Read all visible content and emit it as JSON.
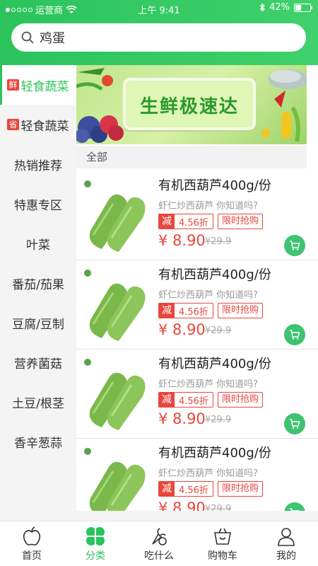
{
  "status": {
    "carrier": "运营商",
    "time": "上午 9:41",
    "battery": "42%",
    "battery_level": 0.42
  },
  "search": {
    "value": "鸡蛋"
  },
  "sidebar": {
    "items": [
      {
        "tag": "鲜",
        "label": "轻食蔬菜"
      },
      {
        "tag": "省",
        "label": "轻食蔬菜"
      },
      {
        "label": "热销推荐"
      },
      {
        "label": "特惠专区"
      },
      {
        "label": "叶菜"
      },
      {
        "label": "番茄/茄果"
      },
      {
        "label": "豆腐/豆制"
      },
      {
        "label": "营养菌菇"
      },
      {
        "label": "土豆/根茎"
      },
      {
        "label": "香辛葱蒜"
      }
    ]
  },
  "banner": {
    "title": "生鲜极速达"
  },
  "section": {
    "label": "全部"
  },
  "products": [
    {
      "name": "有机西葫芦400g/份",
      "desc": "虾仁炒西葫芦 你知道吗?",
      "jian": "减",
      "rate": "4.56折",
      "flash": "限时抢购",
      "price": "¥ 8.90",
      "old_price": "¥29.9"
    },
    {
      "name": "有机西葫芦400g/份",
      "desc": "虾仁炒西葫芦 你知道吗?",
      "jian": "减",
      "rate": "4.56折",
      "flash": "限时抢购",
      "price": "¥ 8.90",
      "old_price": "¥29.9"
    },
    {
      "name": "有机西葫芦400g/份",
      "desc": "虾仁炒西葫芦 你知道吗?",
      "jian": "减",
      "rate": "4.56折",
      "flash": "限时抢购",
      "price": "¥ 8.90",
      "old_price": "¥29.9"
    },
    {
      "name": "有机西葫芦400g/份",
      "desc": "虾仁炒西葫芦 你知道吗?",
      "jian": "减",
      "rate": "4.56折",
      "flash": "限时抢购",
      "price": "¥ 8.90",
      "old_price": "¥29.9"
    }
  ],
  "tabs": [
    {
      "label": "首页",
      "icon": "apple-icon"
    },
    {
      "label": "分类",
      "icon": "clover-icon"
    },
    {
      "label": "吃什么",
      "icon": "vegetables-icon"
    },
    {
      "label": "购物车",
      "icon": "cart-icon"
    },
    {
      "label": "我的",
      "icon": "user-icon"
    }
  ],
  "colors": {
    "brand": "#2bc35c",
    "accent_red": "#e8463c"
  }
}
